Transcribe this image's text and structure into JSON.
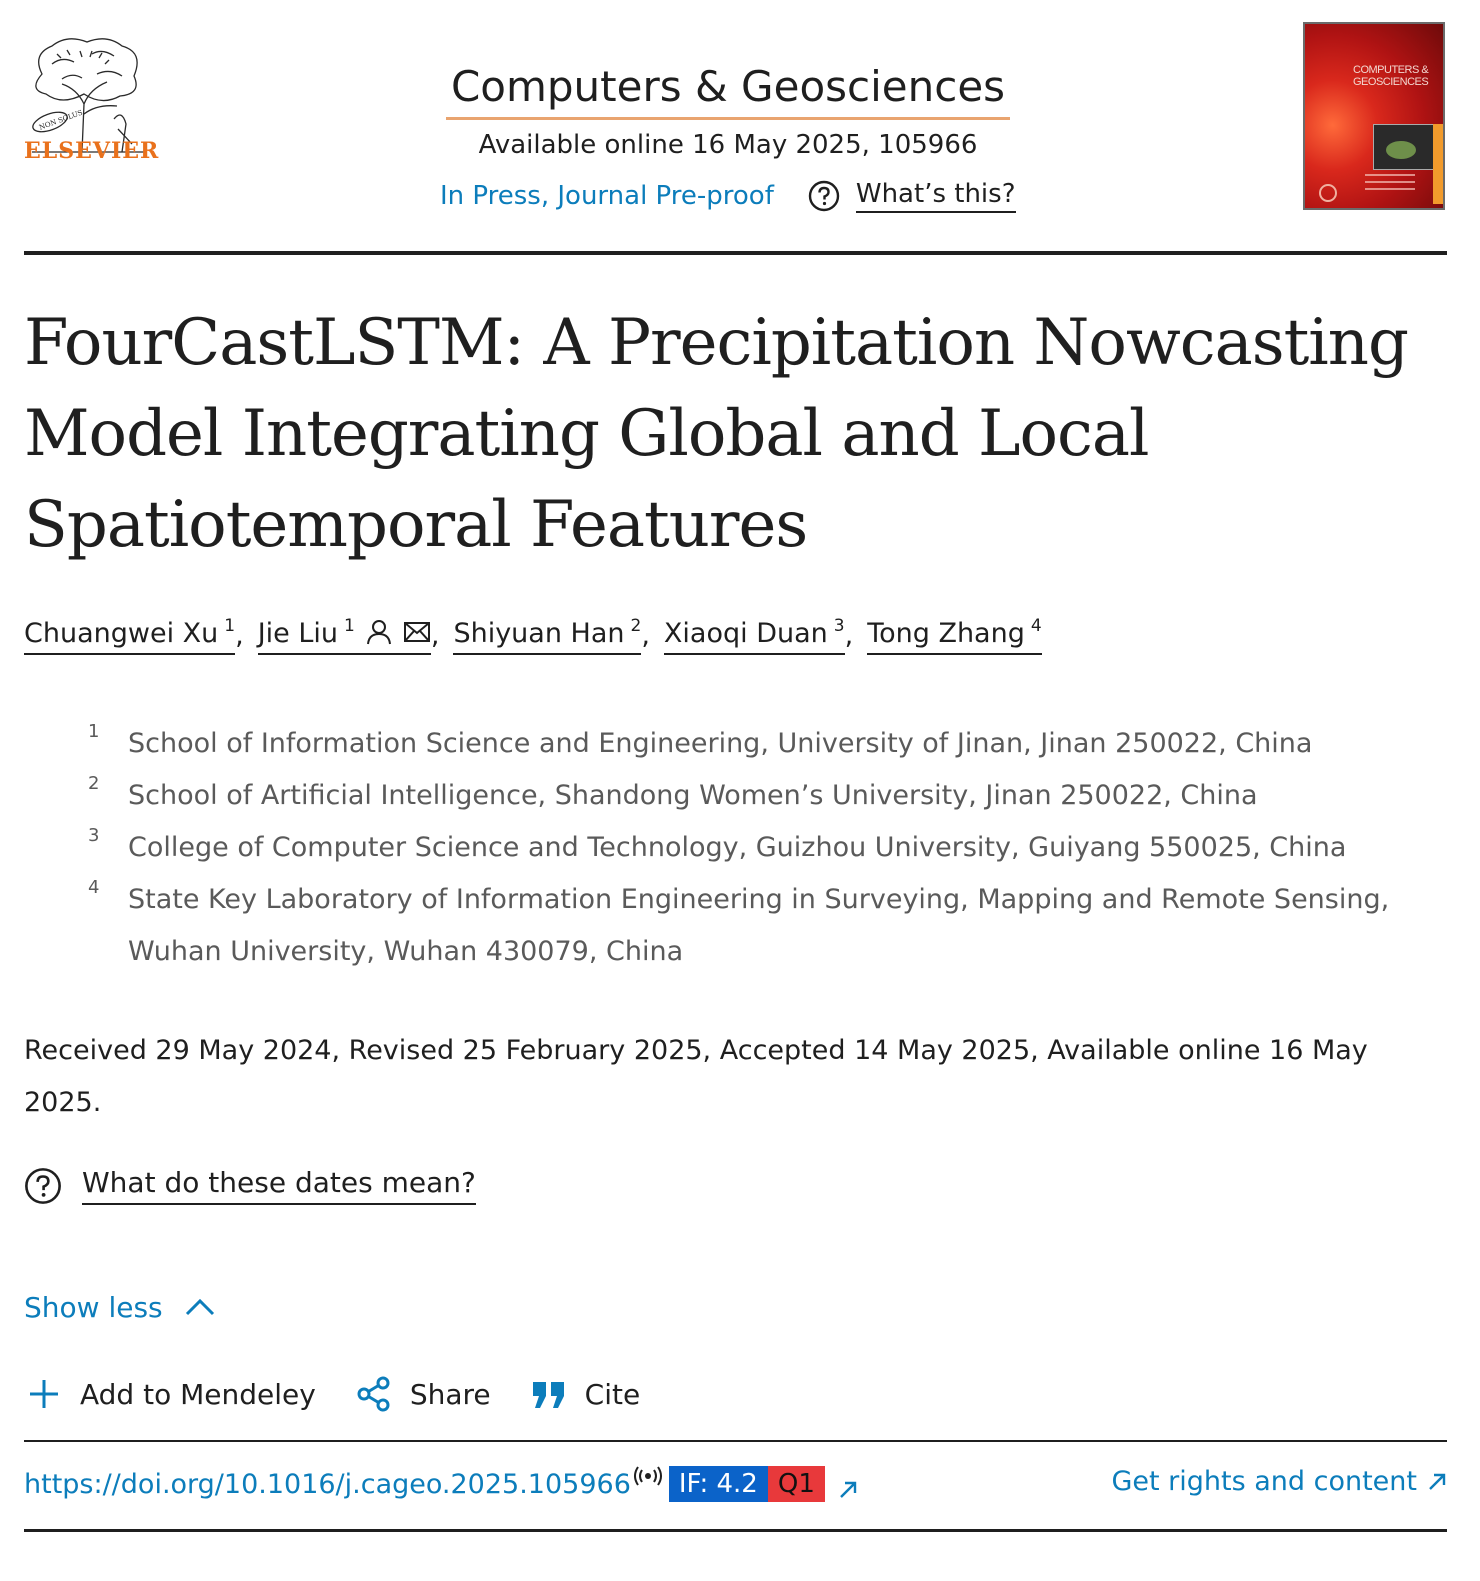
{
  "header": {
    "publisher_logo_text": "ELSEVIER",
    "logo_motto": "NON SOLUS",
    "journal_title": "Computers & Geosciences",
    "available_online": "Available online 16 May 2025, 105966",
    "status_link": "In Press, Journal Pre-proof",
    "whats_this": "What’s this?",
    "cover_title": "COMPUTERS & GEOSCIENCES"
  },
  "article": {
    "title": "FourCastLSTM: A Precipitation Nowcasting Model Integrating Global and Local Spatiotemporal Features"
  },
  "authors": [
    {
      "name": "Chuangwei Xu",
      "sup": "1"
    },
    {
      "name": "Jie Liu",
      "sup": "1"
    },
    {
      "name": "Shiyuan Han",
      "sup": "2"
    },
    {
      "name": "Xiaoqi Duan",
      "sup": "3"
    },
    {
      "name": "Tong Zhang",
      "sup": "4"
    }
  ],
  "separator": ",",
  "affiliations": [
    {
      "num": "1",
      "text": "School of Information Science and Engineering, University of Jinan, Jinan 250022, China"
    },
    {
      "num": "2",
      "text": "School of Artificial Intelligence, Shandong Women’s University, Jinan 250022, China"
    },
    {
      "num": "3",
      "text": "College of Computer Science and Technology, Guizhou University, Guiyang 550025, China"
    },
    {
      "num": "4",
      "text": "State Key Laboratory of Information Engineering in Surveying, Mapping and Remote Sensing, Wuhan University, Wuhan 430079, China"
    }
  ],
  "dates": {
    "text": "Received 29 May 2024, Revised 25 February 2025, Accepted 14 May 2025, Available online 16 May 2025.",
    "help_link": "What do these dates mean?"
  },
  "show_less": "Show less",
  "toolbar": {
    "mendeley": "Add to Mendeley",
    "share": "Share",
    "cite": "Cite"
  },
  "doi": {
    "url": "https://doi.org/10.1016/j.cageo.2025.105966",
    "impact_factor": "IF: 4.2",
    "quartile": "Q1"
  },
  "rights_link": "Get rights and content",
  "colors": {
    "link": "#0c7dbb",
    "brand_orange": "#e9711c",
    "if_badge": "#0b63c9",
    "quartile_badge": "#e8393b"
  },
  "icons": [
    "question-circle-icon",
    "person-icon",
    "envelope-icon",
    "chevron-up-icon",
    "plus-icon",
    "share-icon",
    "quote-icon",
    "radio-waves-icon",
    "external-arrow-icon"
  ]
}
